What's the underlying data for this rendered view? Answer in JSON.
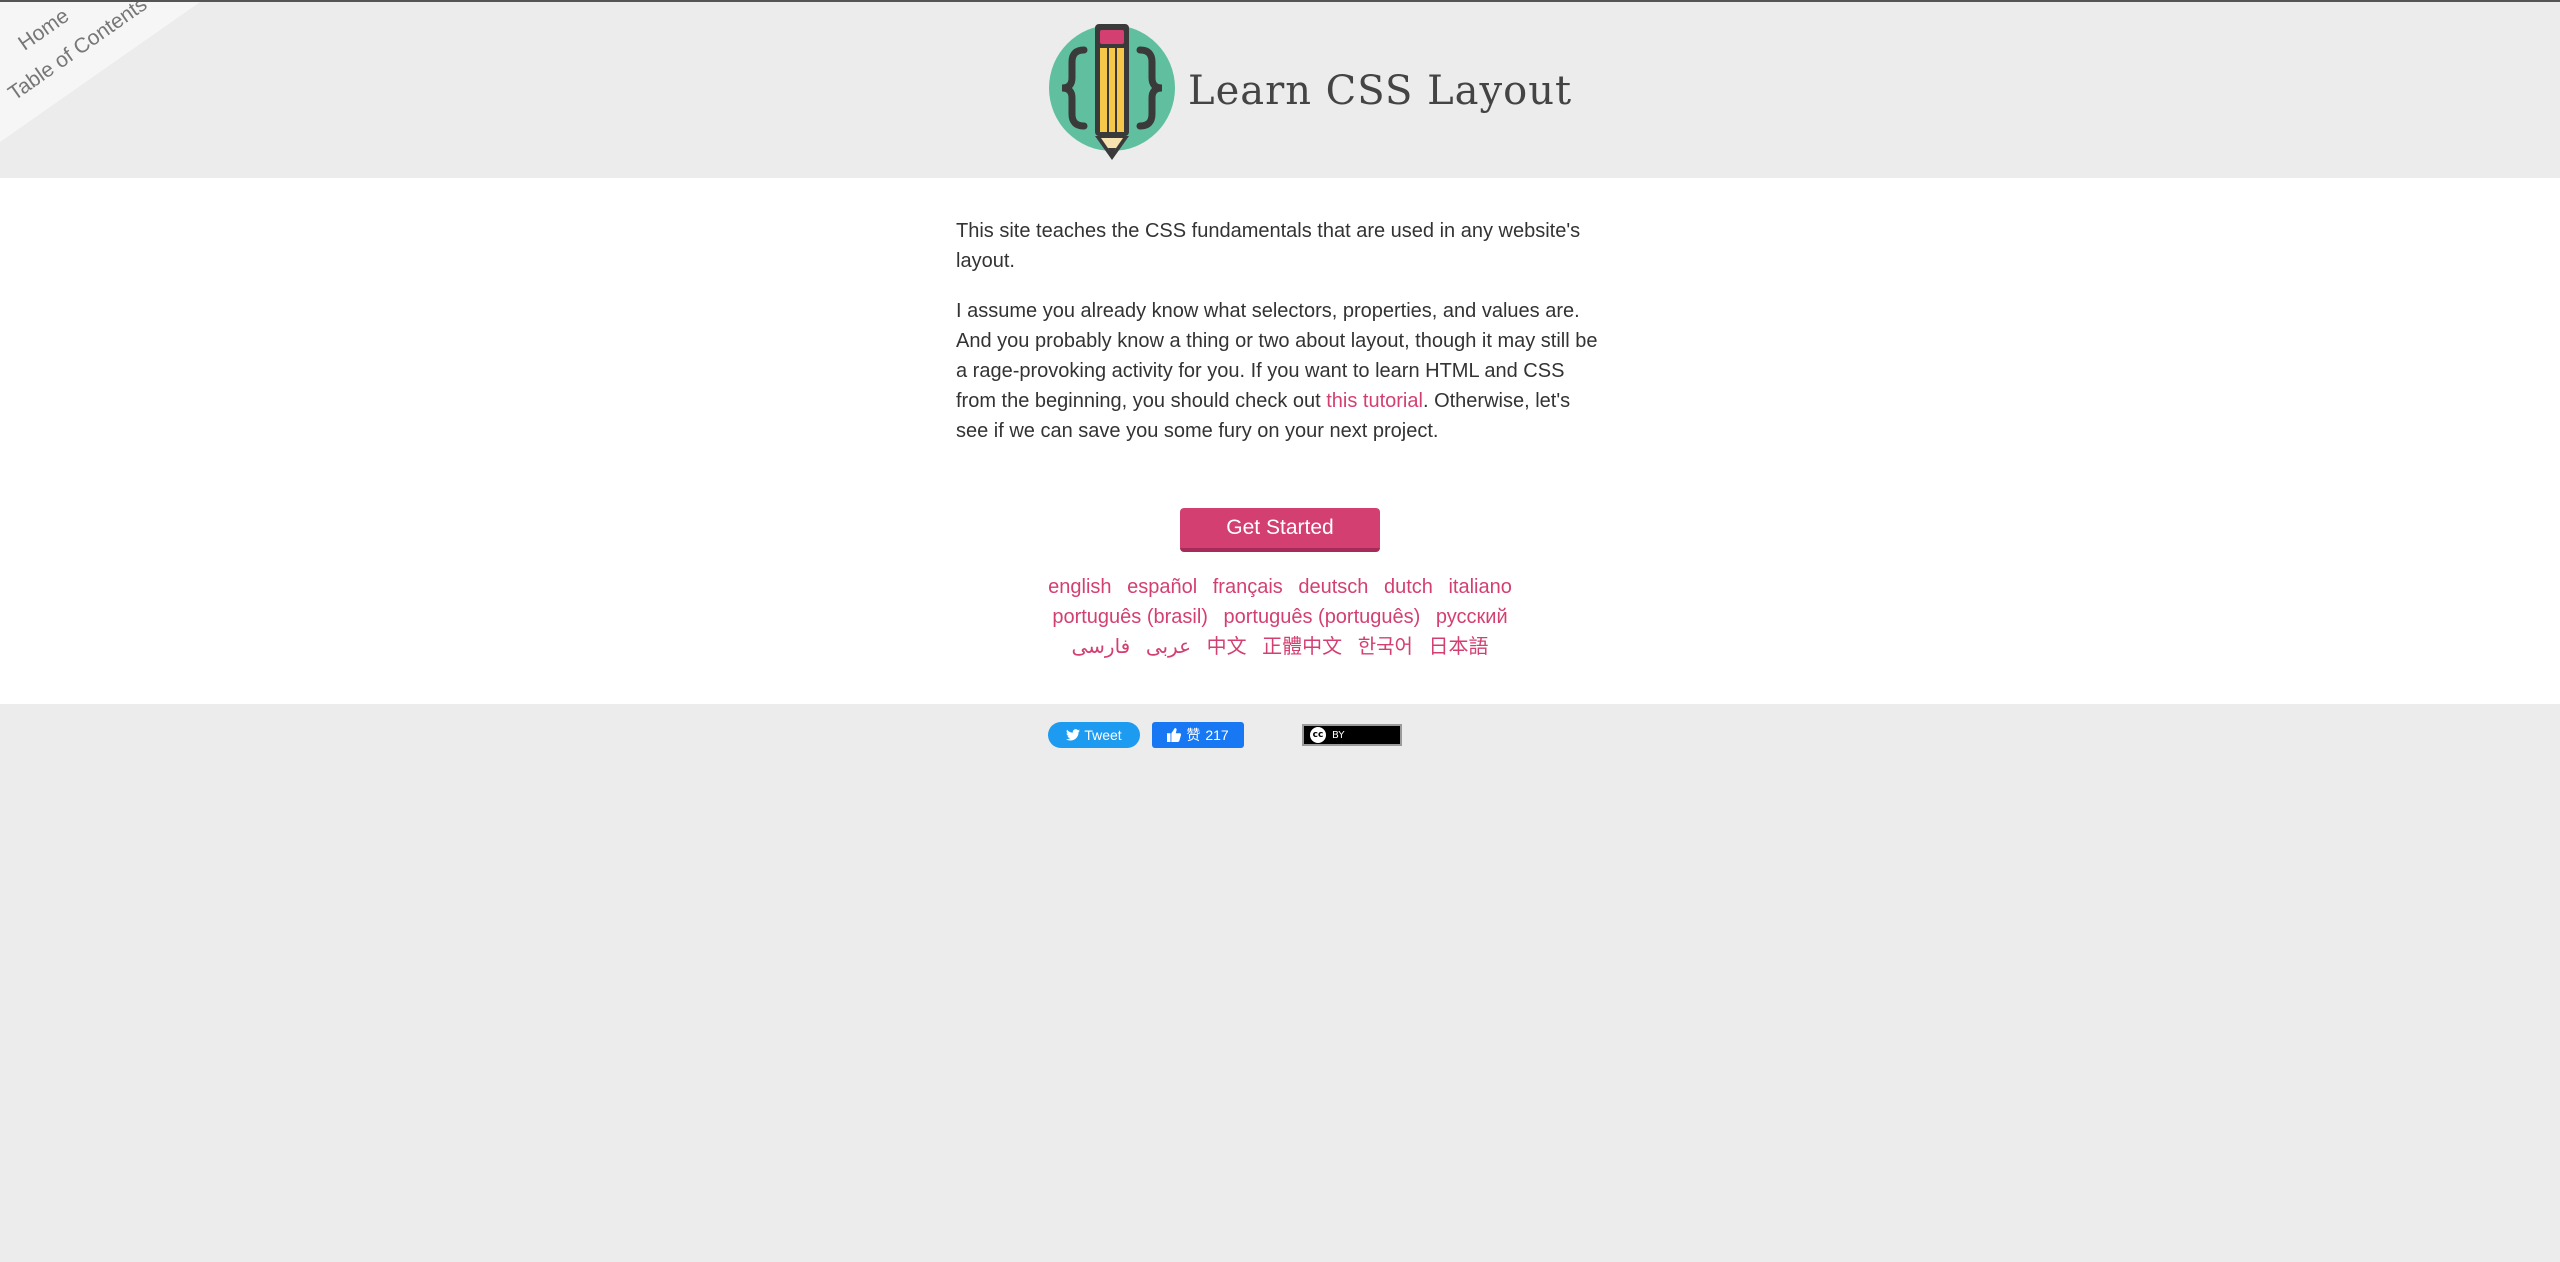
{
  "nav": {
    "home_label": "Home",
    "toc_label": "Table of Contents"
  },
  "header": {
    "title": "Learn CSS Layout",
    "logo_icon": "pencil-braces-logo-icon"
  },
  "intro": {
    "p1": "This site teaches the CSS fundamentals that are used in any website's layout.",
    "p2_before": "I assume you already know what selectors, properties, and values are. And you probably know a thing or two about layout, though it may still be a rage-provoking activity for you. If you want to learn HTML and CSS from the beginning, you should check out ",
    "p2_link": "this tutorial",
    "p2_after": ". Otherwise, let's see if we can save you some fury on your next project."
  },
  "cta": {
    "label": "Get Started"
  },
  "languages": {
    "row1": [
      "english",
      "español",
      "français",
      "deutsch",
      "dutch",
      "italiano"
    ],
    "row2": [
      "português (brasil)",
      "português (português)",
      "русский"
    ],
    "row3": [
      "عربى",
      "فارسی",
      "中文",
      "正體中文",
      "한국어",
      "日本語"
    ]
  },
  "footer": {
    "tweet_label": "Tweet",
    "like_label": "赞",
    "like_count": "217",
    "license_label": "BY",
    "license_icon": "creative-commons-icon"
  },
  "colors": {
    "accent": "#d43f72",
    "header_bg": "#ececec",
    "content_bg": "#ffffff",
    "logo_circle": "#5fbf9f",
    "pencil_yellow": "#f6c94a",
    "twitter": "#1d9bf0",
    "facebook": "#1877f2"
  }
}
